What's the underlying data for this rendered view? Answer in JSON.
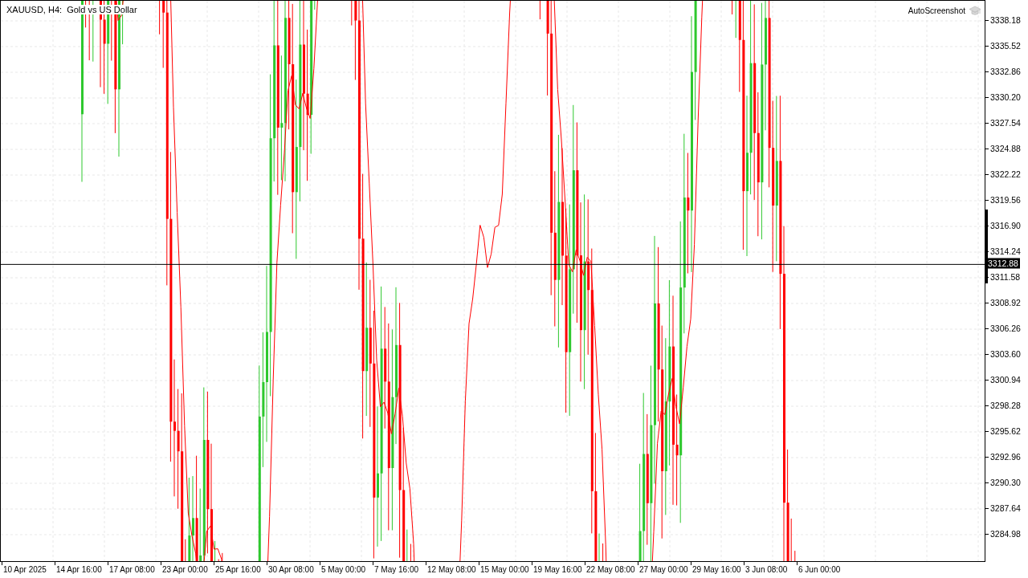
{
  "chart_title": "XAUUSD, H4:  Gold vs US Dollar",
  "watermark_label": "AutoScreenshot",
  "price_axis": [
    "3338.18",
    "3335.52",
    "3332.86",
    "3330.20",
    "3327.54",
    "3324.88",
    "3322.22",
    "3319.56",
    "3316.90",
    "3314.24",
    "3311.58",
    "3308.92",
    "3306.26",
    "3303.60",
    "3300.94",
    "3298.28",
    "3295.62",
    "3292.96",
    "3290.30",
    "3287.64",
    "3284.98"
  ],
  "current_price": "3312.88",
  "time_axis": [
    "10 Apr 2025",
    "14 Apr 16:00",
    "17 Apr 08:00",
    "23 Apr 00:00",
    "25 Apr 16:00",
    "30 Apr 08:00",
    "5 May 00:00",
    "7 May 16:00",
    "12 May 08:00",
    "15 May 00:00",
    "19 May 16:00",
    "22 May 08:00",
    "27 May 00:00",
    "29 May 16:00",
    "3 Jun 08:00",
    "6 Jun 00:00"
  ]
}
